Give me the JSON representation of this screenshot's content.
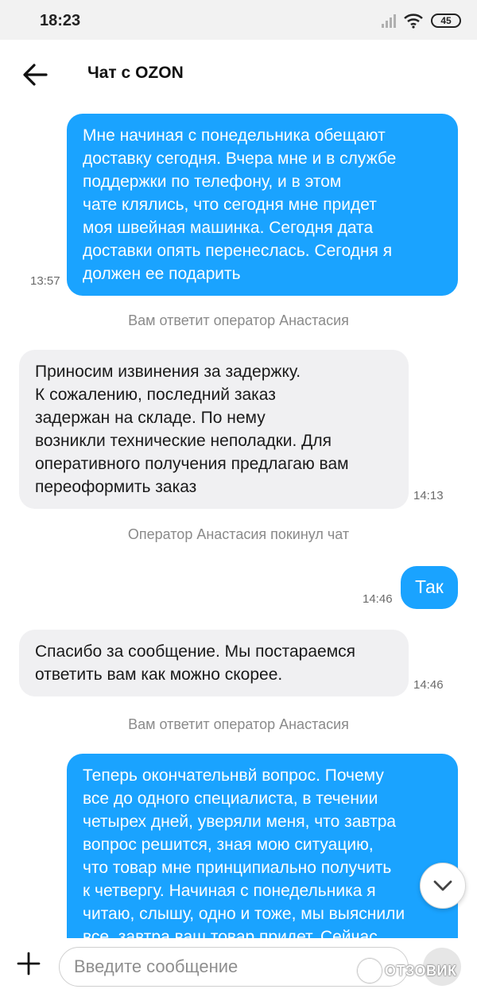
{
  "status_bar": {
    "time": "18:23",
    "battery": "45",
    "icons": [
      "signal-icon",
      "wifi-icon",
      "battery-icon"
    ]
  },
  "header": {
    "title": "Чат с OZON",
    "back_icon": "arrow-left-icon"
  },
  "messages": [
    {
      "direction": "out",
      "lines": [
        "Мне начиная с понедельника обещают",
        "доставку сегодня. Вчера мне и в службе",
        "поддержки по телефону, и в этом",
        "чате клялись, что сегодня мне придет",
        "моя швейная машинка. Сегодня  дата",
        "доставки опять перенеслась. Сегодня я",
        "должен ее подарить"
      ],
      "time": "13:57"
    },
    {
      "system": "Вам ответит оператор Анастасия"
    },
    {
      "direction": "in",
      "lines": [
        "Приносим извинения за задержку.",
        "К сожалению, последний заказ",
        "задержан на складе. По нему",
        "возникли технические неполадки. Для",
        "оперативного получения предлагаю вам",
        "переоформить заказ"
      ],
      "time": "14:13"
    },
    {
      "system": "Оператор Анастасия покинул чат"
    },
    {
      "direction": "out",
      "lines": [
        "Так"
      ],
      "time": "14:46"
    },
    {
      "direction": "in",
      "lines": [
        "Спасибо за сообщение. Мы постараемся",
        "ответить вам как можно скорее."
      ],
      "time": "14:46"
    },
    {
      "system": "Вам ответит оператор Анастасия"
    },
    {
      "direction": "out",
      "lines": [
        "Теперь окончательнвй вопрос. Почему",
        "все до одного специалиста, в течении",
        "четырех дней, уверяли меня, что завтра",
        "вопрос решится, зная мою ситуацию,",
        "что товар мне принципиально получить",
        "к четвергу. Начиная с понедельника я",
        "читаю, слышу, одно и тоже, мы выяснили",
        "все, завтра ваш товар придет. Сейчас"
      ]
    }
  ],
  "scroll_down_icon": "chevron-down-icon",
  "input_bar": {
    "placeholder": "Введите сообщение",
    "attach_icon": "plus-icon",
    "send_icon": "send-icon"
  },
  "watermark": "ОТЗОВИК",
  "colors": {
    "accent": "#1aa3ff",
    "incoming_bubble": "#f0f0f2",
    "system_text": "#8a8a8a"
  }
}
